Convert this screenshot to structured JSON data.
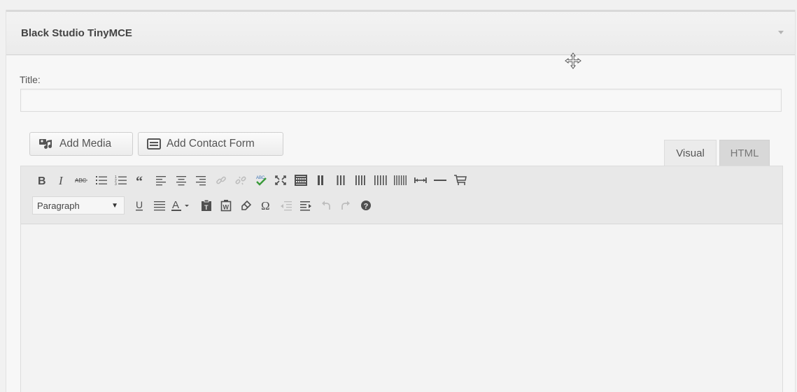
{
  "widget": {
    "title": "Black Studio TinyMCE",
    "title_label": "Title:",
    "title_value": ""
  },
  "buttons": {
    "add_media": "Add Media",
    "add_contact_form": "Add Contact Form"
  },
  "tabs": {
    "visual": "Visual",
    "html": "HTML"
  },
  "toolbar": {
    "format_select": "Paragraph",
    "row1_icons": [
      "bold-icon",
      "italic-icon",
      "strikethrough-icon",
      "bullet-list-icon",
      "numbered-list-icon",
      "blockquote-icon",
      "align-left-icon",
      "align-center-icon",
      "align-right-icon",
      "link-icon",
      "unlink-icon",
      "spellcheck-icon",
      "fullscreen-icon",
      "toolbar-toggle-icon",
      "columns-2-icon",
      "columns-3-icon",
      "columns-4-icon",
      "columns-5-icon",
      "columns-6-icon",
      "spacer-icon",
      "horizontal-rule-icon",
      "shopping-cart-icon"
    ],
    "row2_icons": [
      "underline-icon",
      "justify-icon",
      "text-color-icon",
      "paste-text-icon",
      "paste-word-icon",
      "clear-formatting-icon",
      "special-character-icon",
      "outdent-icon",
      "indent-icon",
      "undo-icon",
      "redo-icon",
      "help-icon"
    ]
  },
  "colors": {
    "icon": "#505050",
    "icon_disabled": "#bdbdbd",
    "spellcheck_green": "#3a9a3a",
    "spellcheck_blue": "#3a73b5"
  }
}
